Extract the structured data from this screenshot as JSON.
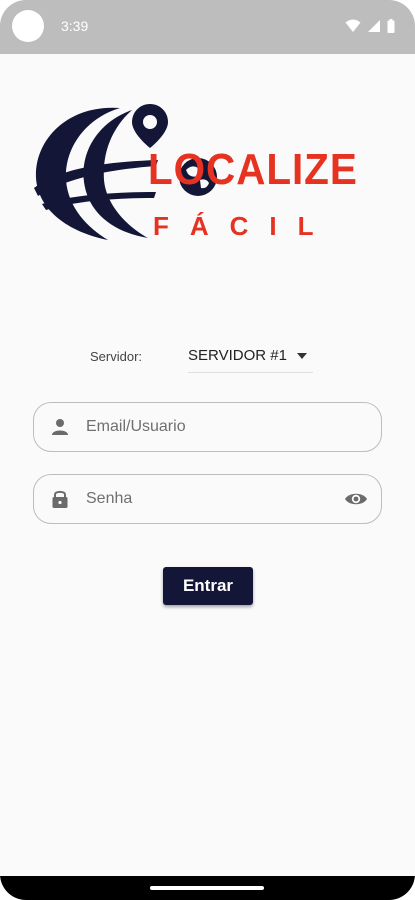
{
  "status_bar": {
    "time": "3:39"
  },
  "logo": {
    "main": "LOCALIZE",
    "sub": "FÁCIL",
    "accent_color": "#e53221",
    "dark_color": "#141638"
  },
  "server": {
    "label": "Servidor:",
    "selected": "SERVIDOR #1"
  },
  "email_field": {
    "placeholder": "Email/Usuario"
  },
  "password_field": {
    "placeholder": "Senha"
  },
  "login_button": {
    "label": "Entrar"
  }
}
